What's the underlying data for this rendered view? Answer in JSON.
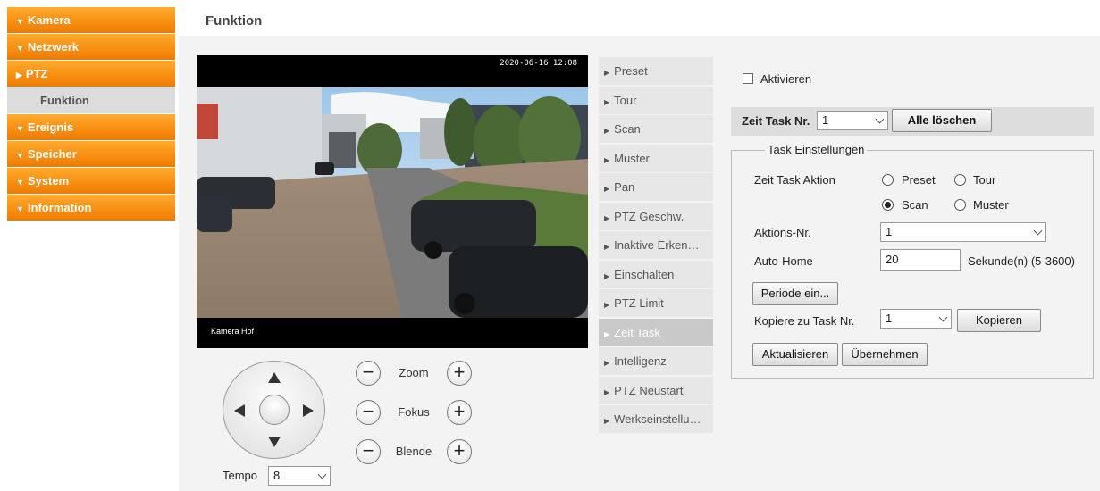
{
  "sidebar": {
    "items": [
      {
        "label": "Kamera",
        "state": "collapsed"
      },
      {
        "label": "Netzwerk",
        "state": "collapsed"
      },
      {
        "label": "PTZ",
        "state": "expanded"
      },
      {
        "label": "Funktion",
        "state": "selected-sub"
      },
      {
        "label": "Ereignis",
        "state": "collapsed"
      },
      {
        "label": "Speicher",
        "state": "collapsed"
      },
      {
        "label": "System",
        "state": "collapsed"
      },
      {
        "label": "Information",
        "state": "collapsed"
      }
    ]
  },
  "tab": {
    "label": "Funktion"
  },
  "video": {
    "osd_time": "2020-06-16 12:08",
    "osd_name": "Kamera Hof"
  },
  "ptz": {
    "zoom_label": "Zoom",
    "focus_label": "Fokus",
    "iris_label": "Blende",
    "minus": "−",
    "plus": "+",
    "tempo_label": "Tempo",
    "tempo_value": "8"
  },
  "function_menu": {
    "items": [
      "Preset",
      "Tour",
      "Scan",
      "Muster",
      "Pan",
      "PTZ Geschw.",
      "Inaktive Erken…",
      "Einschalten",
      "PTZ Limit",
      "Zeit Task",
      "Intelligenz",
      "PTZ Neustart",
      "Werkseinstellu…"
    ],
    "active_index": 9
  },
  "panel": {
    "enable_label": "Aktivieren",
    "enable_checked": false,
    "task_no_label": "Zeit Task Nr.",
    "task_no_value": "1",
    "delete_all": "Alle löschen",
    "settings_legend": "Task Einstellungen",
    "action_label": "Zeit Task Aktion",
    "action_options": [
      "Preset",
      "Tour",
      "Scan",
      "Muster"
    ],
    "action_selected": "Scan",
    "action_no_label": "Aktions-Nr.",
    "action_no_value": "1",
    "autohome_label": "Auto-Home",
    "autohome_value": "20",
    "autohome_unit": "Sekunde(n) (5-3600)",
    "period_button": "Periode ein...",
    "copy_label": "Kopiere zu Task Nr.",
    "copy_value": "1",
    "copy_button": "Kopieren",
    "refresh_button": "Aktualisieren",
    "apply_button": "Übernehmen"
  },
  "colors": {
    "accent": "#f7941d",
    "menu_active": "#c9c9c9",
    "panel_bg": "#f3f3f3"
  }
}
